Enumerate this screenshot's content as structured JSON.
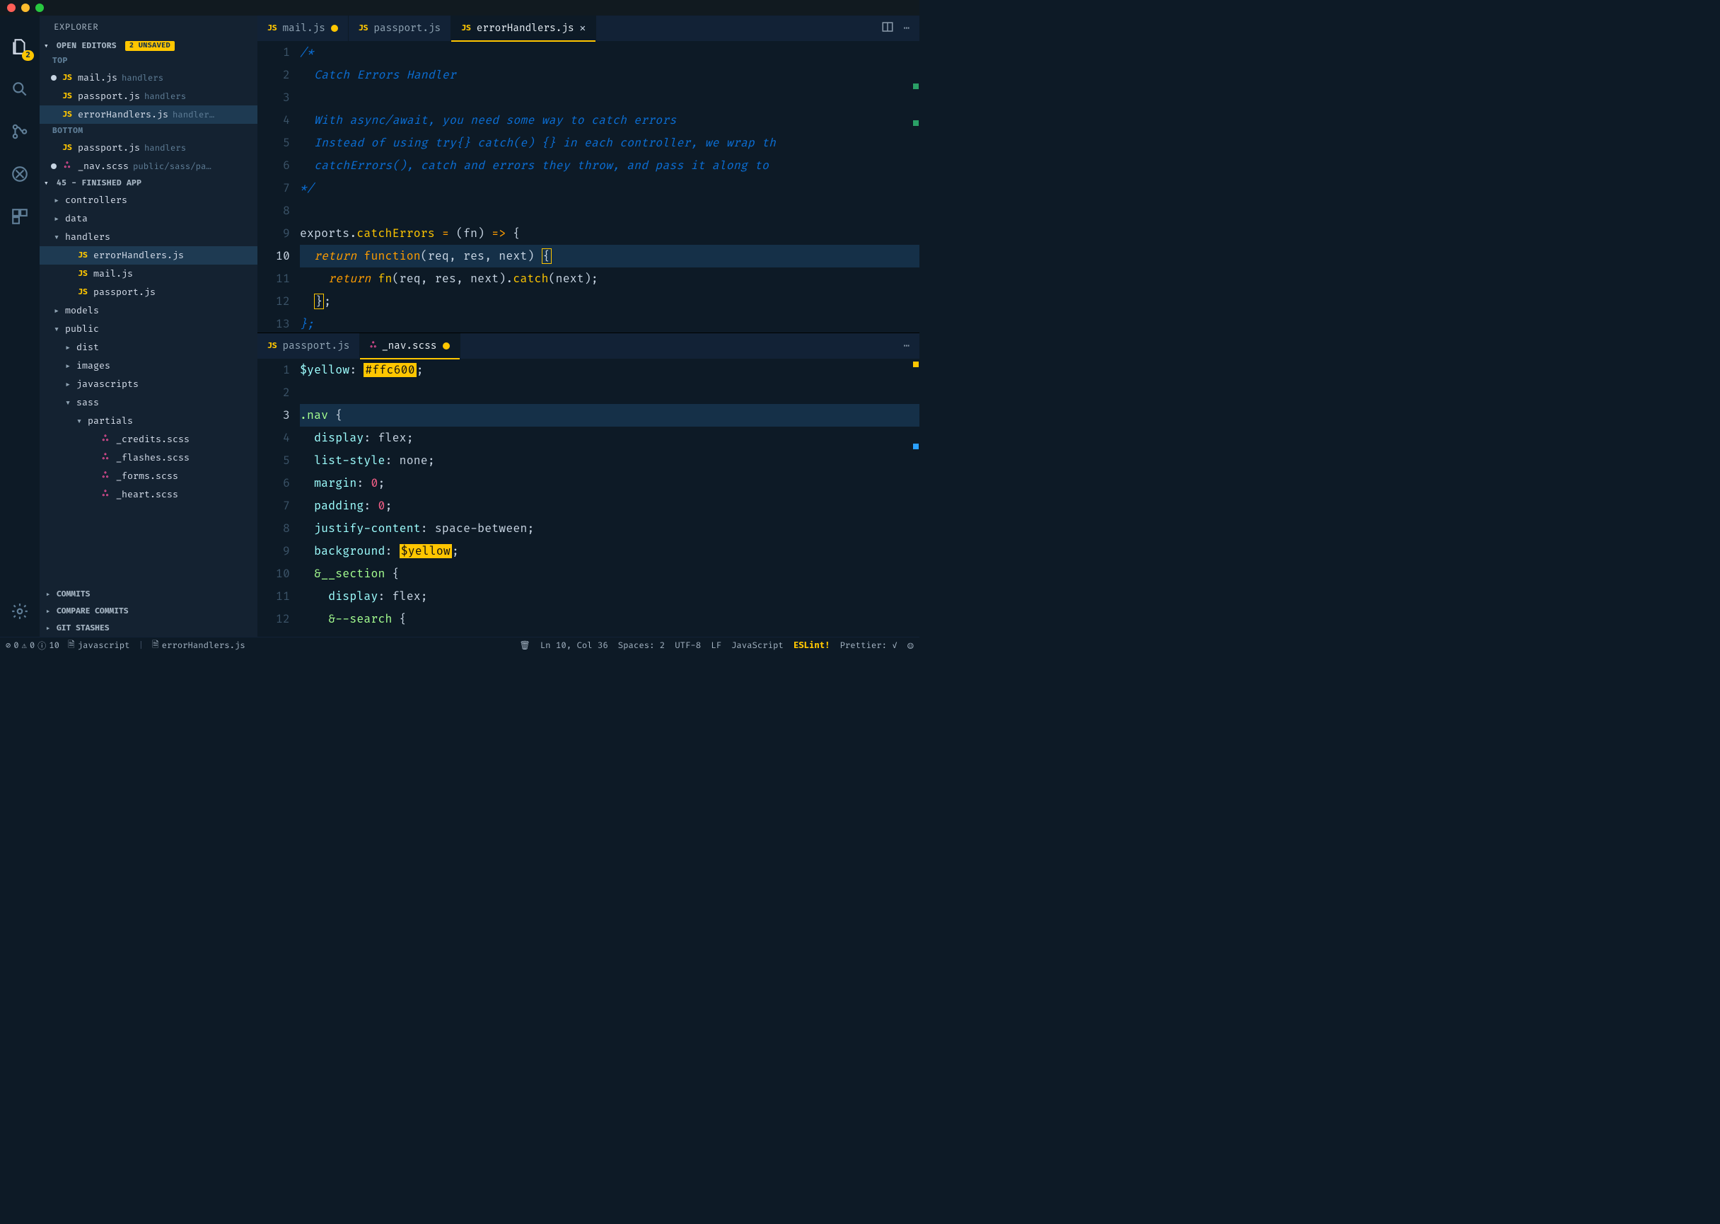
{
  "sidebar": {
    "title": "EXPLORER",
    "openEditors": {
      "label": "OPEN EDITORS",
      "unsavedBadge": "2 UNSAVED",
      "groups": [
        {
          "name": "TOP",
          "files": [
            {
              "icon": "JS",
              "iconClass": "js",
              "name": "mail.js",
              "path": "handlers",
              "dirty": true
            },
            {
              "icon": "JS",
              "iconClass": "js",
              "name": "passport.js",
              "path": "handlers",
              "dirty": false
            },
            {
              "icon": "JS",
              "iconClass": "js",
              "name": "errorHandlers.js",
              "path": "handler…",
              "dirty": false,
              "selected": true
            }
          ]
        },
        {
          "name": "BOTTOM",
          "files": [
            {
              "icon": "JS",
              "iconClass": "js",
              "name": "passport.js",
              "path": "handlers",
              "dirty": false
            },
            {
              "icon": "ஃ",
              "iconClass": "scss",
              "name": "_nav.scss",
              "path": "public/sass/pa…",
              "dirty": true
            }
          ]
        }
      ]
    },
    "workspace": {
      "label": "45 - FINISHED APP"
    },
    "tree": [
      {
        "depth": 0,
        "type": "folder",
        "state": "closed",
        "name": "controllers"
      },
      {
        "depth": 0,
        "type": "folder",
        "state": "closed",
        "name": "data"
      },
      {
        "depth": 0,
        "type": "folder",
        "state": "open",
        "name": "handlers"
      },
      {
        "depth": 1,
        "type": "file",
        "icon": "JS",
        "iconClass": "js",
        "name": "errorHandlers.js",
        "selected": true
      },
      {
        "depth": 1,
        "type": "file",
        "icon": "JS",
        "iconClass": "js",
        "name": "mail.js"
      },
      {
        "depth": 1,
        "type": "file",
        "icon": "JS",
        "iconClass": "js",
        "name": "passport.js"
      },
      {
        "depth": 0,
        "type": "folder",
        "state": "closed",
        "name": "models"
      },
      {
        "depth": 0,
        "type": "folder",
        "state": "open",
        "name": "public"
      },
      {
        "depth": 1,
        "type": "folder",
        "state": "closed",
        "name": "dist"
      },
      {
        "depth": 1,
        "type": "folder",
        "state": "closed",
        "name": "images"
      },
      {
        "depth": 1,
        "type": "folder",
        "state": "closed",
        "name": "javascripts"
      },
      {
        "depth": 1,
        "type": "folder",
        "state": "open",
        "name": "sass"
      },
      {
        "depth": 2,
        "type": "folder",
        "state": "open",
        "name": "partials"
      },
      {
        "depth": 3,
        "type": "file",
        "icon": "ஃ",
        "iconClass": "scss",
        "name": "_credits.scss"
      },
      {
        "depth": 3,
        "type": "file",
        "icon": "ஃ",
        "iconClass": "scss",
        "name": "_flashes.scss"
      },
      {
        "depth": 3,
        "type": "file",
        "icon": "ஃ",
        "iconClass": "scss",
        "name": "_forms.scss"
      },
      {
        "depth": 3,
        "type": "file",
        "icon": "ஃ",
        "iconClass": "scss",
        "name": "_heart.scss"
      }
    ],
    "footerPanels": [
      "COMMITS",
      "COMPARE COMMITS",
      "GIT STASHES"
    ]
  },
  "activitybar": {
    "badge": "2"
  },
  "topEditor": {
    "tabs": [
      {
        "icon": "JS",
        "iconClass": "js",
        "label": "mail.js",
        "dirty": true
      },
      {
        "icon": "JS",
        "iconClass": "js",
        "label": "passport.js"
      },
      {
        "icon": "JS",
        "iconClass": "js",
        "label": "errorHandlers.js",
        "active": true,
        "close": true
      }
    ],
    "startLine": 1,
    "currentLine": 10,
    "lines": [
      {
        "n": 1,
        "raw": "/*",
        "cls": "comment"
      },
      {
        "n": 2,
        "raw": "  Catch Errors Handler",
        "cls": "comment"
      },
      {
        "n": 3,
        "raw": "",
        "cls": "comment"
      },
      {
        "n": 4,
        "raw": "  With async/await, you need some way to catch errors",
        "cls": "comment"
      },
      {
        "n": 5,
        "raw": "  Instead of using try{} catch(e) {} in each controller, we wrap th",
        "cls": "comment"
      },
      {
        "n": 6,
        "raw": "  catchErrors(), catch and errors they throw, and pass it along to ",
        "cls": "comment"
      },
      {
        "n": 7,
        "raw": "*/",
        "cls": "comment"
      },
      {
        "n": 8,
        "raw": ""
      },
      {
        "n": 9,
        "html": "exports.<span class='tok-fn'>catchErrors</span> <span class='tok-op'>=</span> (fn) <span class='tok-op'>=&gt;</span> {"
      },
      {
        "n": 10,
        "html": "  <span class='tok-kw'>return</span> <span class='tok-builtin'>function</span>(req, res, next) <span class='brace-hl'>{</span>",
        "highlight": true
      },
      {
        "n": 11,
        "html": "    <span class='tok-kw'>return</span> <span class='tok-fn'>fn</span>(req, res, next).<span class='tok-fn'>catch</span>(next);"
      },
      {
        "n": 12,
        "html": "  <span class='brace-hl'>}</span>;"
      },
      {
        "n": 13,
        "html": "<span class='tok-comment'>};</span>"
      }
    ]
  },
  "bottomEditor": {
    "tabs": [
      {
        "icon": "JS",
        "iconClass": "js",
        "label": "passport.js"
      },
      {
        "icon": "ஃ",
        "iconClass": "scss",
        "label": "_nav.scss",
        "dirty": true,
        "active": true
      }
    ],
    "startLine": 1,
    "currentLine": 3,
    "lines": [
      {
        "n": 1,
        "html": "<span class='tok-str'>$yellow</span>: <span class='tok-colorbox'>#ffc600</span>;"
      },
      {
        "n": 2,
        "raw": ""
      },
      {
        "n": 3,
        "html": "<span class='tok-var'>.nav</span> {",
        "highlight": true
      },
      {
        "n": 4,
        "html": "  <span class='tok-str'>display</span>: flex;"
      },
      {
        "n": 5,
        "html": "  <span class='tok-str'>list-style</span>: none;"
      },
      {
        "n": 6,
        "html": "  <span class='tok-str'>margin</span>: <span class='tok-const'>0</span>;"
      },
      {
        "n": 7,
        "html": "  <span class='tok-str'>padding</span>: <span class='tok-const'>0</span>;"
      },
      {
        "n": 8,
        "html": "  <span class='tok-str'>justify-content</span>: space-between;"
      },
      {
        "n": 9,
        "html": "  <span class='tok-str'>background</span>: <span class='tok-colorbox'>$yellow</span>;"
      },
      {
        "n": 10,
        "html": "  <span class='tok-var'>&amp;__section</span> {"
      },
      {
        "n": 11,
        "html": "    <span class='tok-str'>display</span>: flex;"
      },
      {
        "n": 12,
        "html": "    <span class='tok-var'>&amp;--search</span> {"
      }
    ]
  },
  "status": {
    "errors": "0",
    "warnings": "0",
    "info": "10",
    "lang1": "javascript",
    "filepath": "errorHandlers.js",
    "lncol": "Ln 10, Col 36",
    "spaces": "Spaces: 2",
    "enc": "UTF-8",
    "eol": "LF",
    "language": "JavaScript",
    "eslint": "ESLint!",
    "prettier": "Prettier: ✓"
  }
}
